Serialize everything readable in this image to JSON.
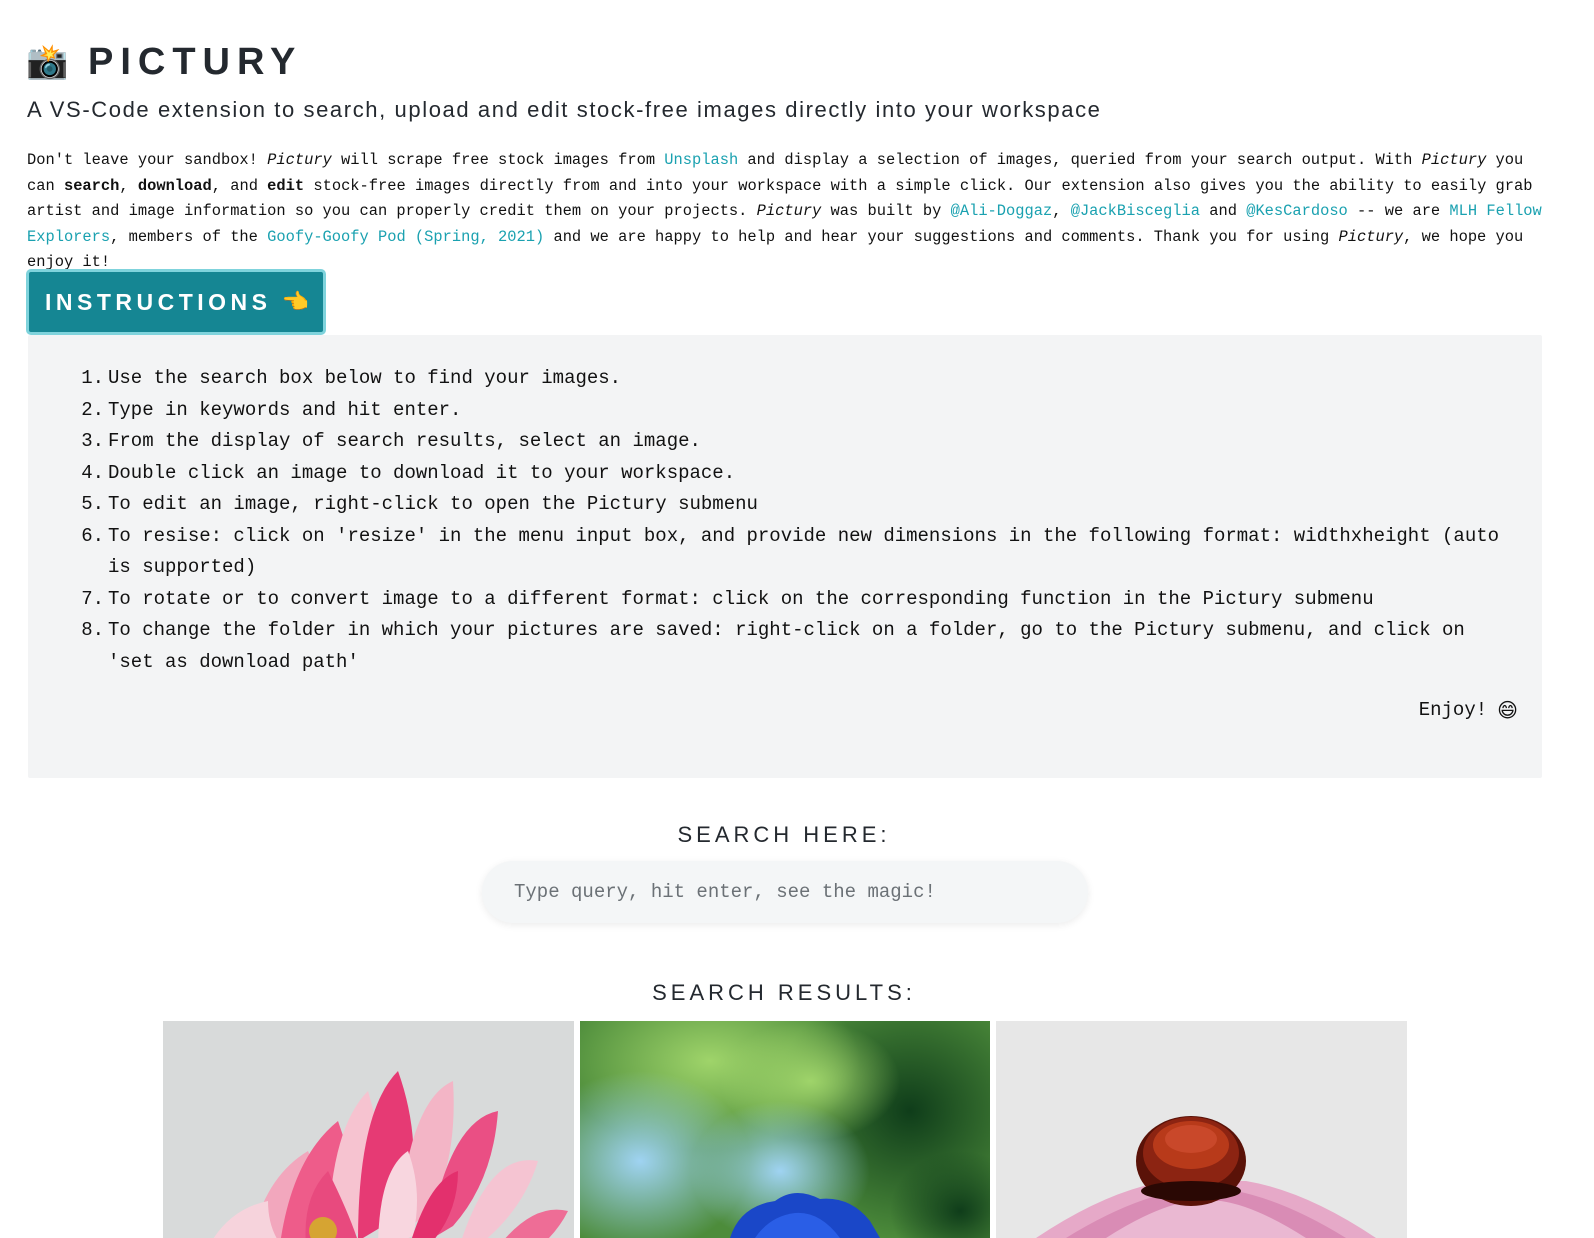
{
  "app": {
    "icon": "camera-flash-icon",
    "title": "PICTURY",
    "subtitle": "A VS-Code extension to search, upload and edit stock-free images directly into your workspace"
  },
  "intro": {
    "p1": "Don't leave your sandbox! ",
    "pictury1": "Pictury",
    "p2": " will scrape free stock images from ",
    "unsplash": "Unsplash",
    "p3": " and display a selection of images, queried from your search output. With ",
    "pictury2": "Pictury",
    "p4": " you can ",
    "search": "search",
    "comma1": ", ",
    "download": "download",
    "and1": ", and ",
    "edit": "edit",
    "p5": " stock-free images directly from and into your workspace with a simple click. Our extension also gives you the ability to easily grab artist and image information so you can properly credit them on your projects. ",
    "pictury3": "Pictury",
    "p6": " was built by ",
    "author1": "@Ali-Doggaz",
    "comma2": ", ",
    "author2": "@JackBisceglia",
    "and2": " and ",
    "author3": "@KesCardoso",
    "p7": " -- we are ",
    "mlh": "MLH Fellow Explorers",
    "p8": ", members of the ",
    "pod": "Goofy-Goofy Pod (Spring, 2021)",
    "p9": " and we are happy to help and hear your suggestions and comments. Thank you for using ",
    "pictury4": "Pictury",
    "p10": ", we hope you enjoy it!"
  },
  "instructions": {
    "button_label": "INSTRUCTIONS",
    "button_icon": "pointing-hand-icon",
    "steps": [
      {
        "num": "1.",
        "text": "Use the search box below to find your images."
      },
      {
        "num": "2.",
        "text": "Type in keywords and hit enter."
      },
      {
        "num": "3.",
        "text": "From the display of search results, select an image."
      },
      {
        "num": "4.",
        "text": "Double click an image to download it to your workspace."
      },
      {
        "num": "5.",
        "text": "To edit an image, right-click to open the Pictury submenu"
      },
      {
        "num": "6.",
        "text": "To resise: click on 'resize' in the menu input box, and provide new dimensions in the following format: widthxheight (auto is supported)"
      },
      {
        "num": "7.",
        "text": "To rotate or to convert image to a different format: click on the corresponding function in the Pictury submenu"
      },
      {
        "num": "8.",
        "text": "To change the folder in which your pictures are saved: right-click on a folder, go to the Pictury submenu, and click on 'set as download path'"
      }
    ],
    "enjoy": "Enjoy!",
    "enjoy_icon": "grinning-face-icon"
  },
  "search": {
    "heading": "SEARCH HERE:",
    "placeholder": "Type query, hit enter, see the magic!",
    "value": ""
  },
  "results": {
    "heading": "SEARCH RESULTS:",
    "images": [
      {
        "subject": "pink dahlia flower"
      },
      {
        "subject": "blue flower on green bokeh"
      },
      {
        "subject": "pink coneflower"
      }
    ]
  },
  "colors": {
    "accent": "#158693",
    "link": "#1aa1b0",
    "panel_bg": "#f3f4f5"
  }
}
